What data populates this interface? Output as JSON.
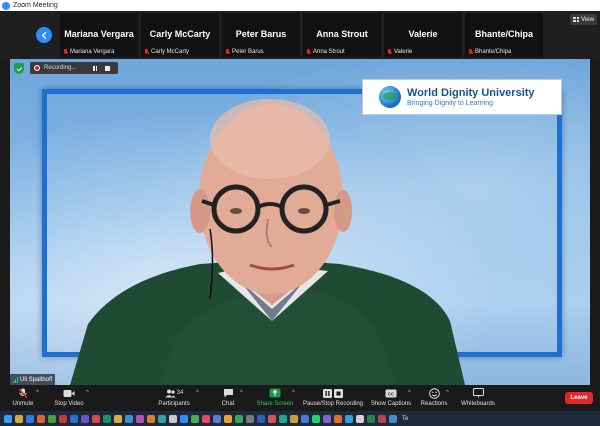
{
  "window": {
    "title": "Zoom Meeting"
  },
  "strip": {
    "participants": [
      {
        "display": "Mariana Vergara",
        "label": "Mariana Vergara"
      },
      {
        "display": "Carly McCarty",
        "label": "Carly McCarty"
      },
      {
        "display": "Peter Barus",
        "label": "Peter Barus"
      },
      {
        "display": "Anna Strout",
        "label": "Anna Strout"
      },
      {
        "display": "Valerie",
        "label": "Valerie"
      },
      {
        "display": "Bhante/Chipa",
        "label": "Bhante/Chipa"
      }
    ],
    "view_label": "View"
  },
  "main": {
    "recording_label": "Recording...",
    "speaker_name": "Uli Spalthoff",
    "logo": {
      "title": "World Dignity University",
      "subtitle": "Bringing Dignity to Learning"
    }
  },
  "toolbar": {
    "unmute": "Unmute",
    "stop_video": "Stop Video",
    "participants": "Participants",
    "participant_count": "34",
    "chat": "Chat",
    "share_screen": "Share Screen",
    "pause_stop_recording": "Pause/Stop Recording",
    "show_captions": "Show Captions",
    "reactions": "Reactions",
    "whiteboards": "Whiteboards",
    "leave": "Leave"
  },
  "taskbar": {
    "trailing_text": "Te"
  },
  "colors": {
    "accent": "#2d8cff",
    "leave": "#e02828",
    "share": "#1e9b4b",
    "frame": "#1f6fcf"
  }
}
